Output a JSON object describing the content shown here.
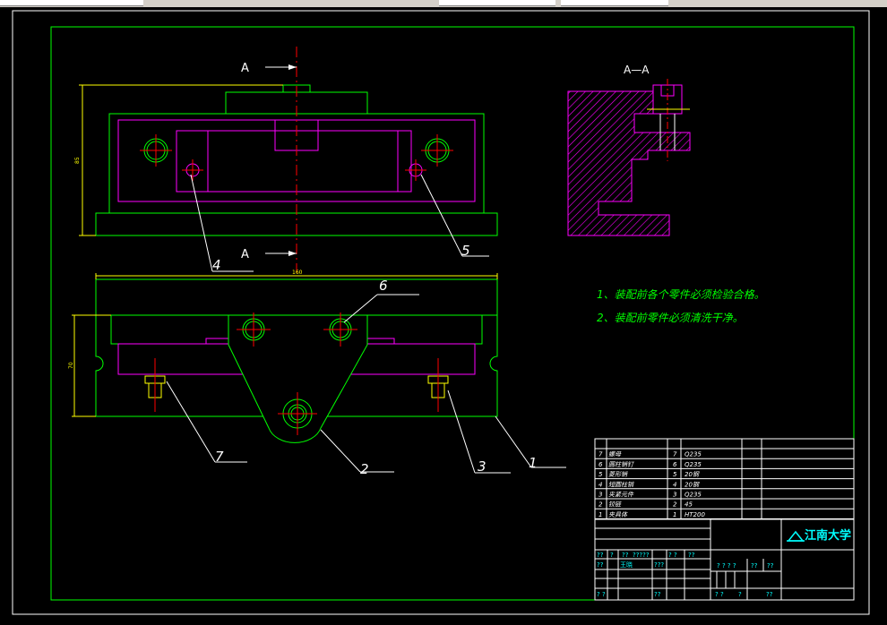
{
  "drawing": {
    "section_label_top": "A",
    "section_label_bottom": "A",
    "section_view_title": "A—A",
    "dimensions": {
      "top_view_height": "85",
      "front_view_width": "160",
      "front_view_height": "70"
    },
    "callouts": [
      "1",
      "2",
      "3",
      "4",
      "5",
      "6",
      "7"
    ]
  },
  "notes": [
    "1、装配前各个零件必须检验合格。",
    "2、装配前零件必须清洗干净。"
  ],
  "bom": {
    "rows": [
      {
        "no": "7",
        "name": "螺母",
        "qty": "7",
        "material": "Q235"
      },
      {
        "no": "6",
        "name": "圆柱销钉",
        "qty": "6",
        "material": "Q235"
      },
      {
        "no": "5",
        "name": "菱形销",
        "qty": "5",
        "material": "20钢"
      },
      {
        "no": "4",
        "name": "短圆柱销",
        "qty": "4",
        "material": "20钢"
      },
      {
        "no": "3",
        "name": "夹紧元件",
        "qty": "3",
        "material": "Q235"
      },
      {
        "no": "2",
        "name": "铰链",
        "qty": "2",
        "material": "45"
      },
      {
        "no": "1",
        "name": "夹具体",
        "qty": "1",
        "material": "HT200"
      }
    ]
  },
  "title_block": {
    "school": "江南大学",
    "row_a": [
      "??",
      "?",
      "??",
      "?????",
      "? ?",
      "??"
    ],
    "row_b": [
      "??",
      "王晓",
      "???"
    ],
    "row_c": [
      "? ? ? ?",
      "??",
      "??"
    ],
    "row_d": [
      "? ?",
      "??",
      "? ?",
      "?",
      "??"
    ]
  },
  "colors": {
    "green": "#00ff00",
    "magenta": "#ff00ff",
    "red": "#ff0000",
    "yellow": "#ffff00",
    "white": "#ffffff",
    "cyan": "#00ffff"
  }
}
